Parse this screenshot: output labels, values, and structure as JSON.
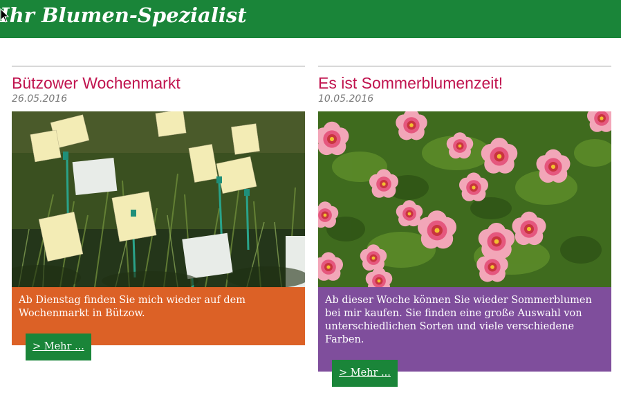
{
  "colors": {
    "header": "#1a8539",
    "title": "#c0134e",
    "teaser_1": "#dc6126",
    "teaser_2": "#7f4e9c",
    "button": "#1a8539"
  },
  "header": {
    "title": "Ihr Blumen-Spezialist"
  },
  "articles": [
    {
      "title": "Bützower Wochenmarkt",
      "date": "26.05.2016",
      "text": "Ab Dienstag finden Sie mich wieder auf dem Wochenmarkt in Bützow.",
      "more_label": "> Mehr ..."
    },
    {
      "title": "Es ist Sommerblumenzeit!",
      "date": "10.05.2016",
      "text": "Ab dieser Woche können Sie wieder Sommerblumen bei mir kaufen. Sie finden eine große Auswahl von unterschiedlichen Sorten und viele verschiedene Farben.",
      "more_label": "> Mehr ..."
    }
  ]
}
